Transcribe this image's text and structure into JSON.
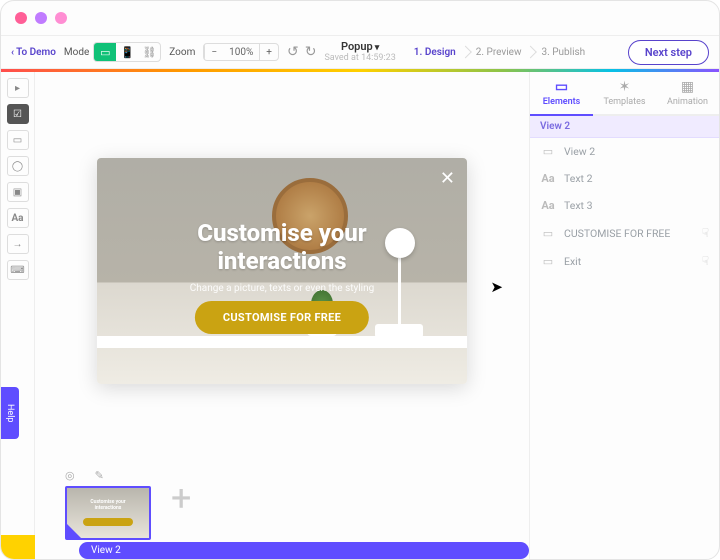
{
  "toolbar": {
    "back_label": "To Demo",
    "mode_label": "Mode",
    "zoom_label": "Zoom",
    "zoom_value": "100%",
    "center_title": "Popup",
    "saved_text": "Saved at 14:59:23",
    "next_label": "Next step"
  },
  "steps": [
    {
      "num": "1.",
      "label": "Design"
    },
    {
      "num": "2.",
      "label": "Preview"
    },
    {
      "num": "3.",
      "label": "Publish"
    }
  ],
  "help_label": "Help",
  "popup": {
    "heading_line1": "Customise your",
    "heading_line2": "interactions",
    "sub": "Change a picture, texts or even the styling",
    "cta": "CUSTOMISE FOR FREE"
  },
  "thumb_pill": "View 2",
  "panel": {
    "tabs": [
      {
        "label": "Elements"
      },
      {
        "label": "Templates"
      },
      {
        "label": "Animation"
      }
    ],
    "view_header": "View 2",
    "layers": [
      {
        "icon": "▭",
        "label": "View 2",
        "trail": ""
      },
      {
        "icon": "Aa",
        "label": "Text 2",
        "trail": ""
      },
      {
        "icon": "Aa",
        "label": "Text 3",
        "trail": ""
      },
      {
        "icon": "▭",
        "label": "CUSTOMISE FOR FREE",
        "trail": "☟"
      },
      {
        "icon": "▭",
        "label": "Exit",
        "trail": "☟"
      }
    ]
  }
}
